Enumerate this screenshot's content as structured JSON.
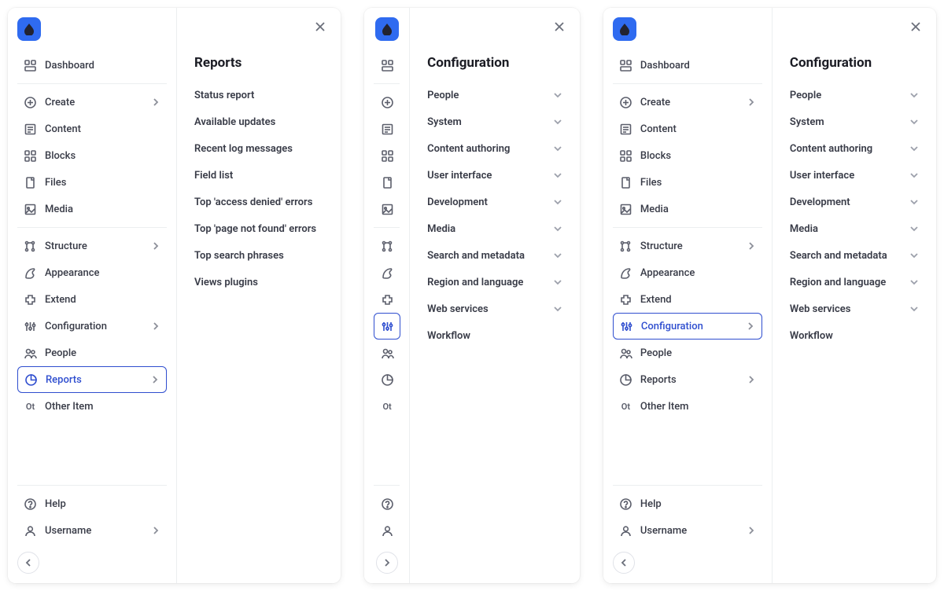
{
  "sidebar": {
    "dashboard": "Dashboard",
    "create": "Create",
    "content": "Content",
    "blocks": "Blocks",
    "files": "Files",
    "media": "Media",
    "structure": "Structure",
    "appearance": "Appearance",
    "extend": "Extend",
    "configuration": "Configuration",
    "people": "People",
    "reports": "Reports",
    "other": "Other Item",
    "other_icon": "Ot",
    "help": "Help",
    "username": "Username"
  },
  "reports_panel": {
    "title": "Reports",
    "items": [
      "Status report",
      "Available updates",
      "Recent log messages",
      "Field list",
      "Top 'access denied' errors",
      "Top 'page not found' errors",
      "Top search phrases",
      "Views plugins"
    ]
  },
  "config_panel": {
    "title": "Configuration",
    "items": [
      {
        "label": "People",
        "expandable": true
      },
      {
        "label": "System",
        "expandable": true
      },
      {
        "label": "Content authoring",
        "expandable": true
      },
      {
        "label": "User interface",
        "expandable": true
      },
      {
        "label": "Development",
        "expandable": true
      },
      {
        "label": "Media",
        "expandable": true
      },
      {
        "label": "Search and metadata",
        "expandable": true
      },
      {
        "label": "Region and language",
        "expandable": true
      },
      {
        "label": "Web services",
        "expandable": true
      },
      {
        "label": "Workflow",
        "expandable": false
      }
    ]
  }
}
